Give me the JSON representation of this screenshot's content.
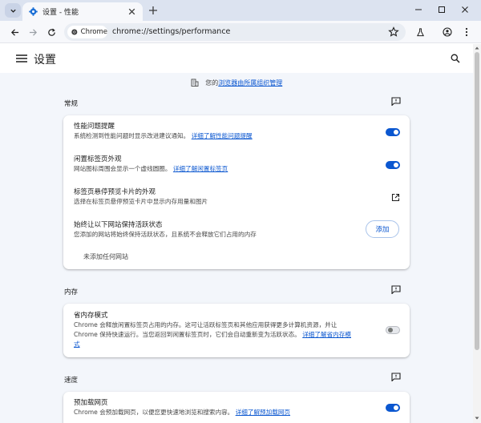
{
  "browser": {
    "tab_title": "设置 - 性能",
    "chip_label": "Chrome",
    "url_scheme": "chrome://",
    "url_rest": "settings/performance"
  },
  "settings": {
    "title": "设置",
    "managed_prefix": "您的",
    "managed_link": "浏览器由所属组织管理"
  },
  "sections": {
    "general": {
      "label": "常规",
      "rows": {
        "perf_alerts": {
          "title": "性能问题提醒",
          "desc": "系统检测到性能问题时显示改进建议通知。",
          "link": "详细了解性能问题提醒",
          "toggle": "on"
        },
        "inactive_tabs": {
          "title": "闲置标签页外观",
          "desc": "网站图标周围会显示一个虚线圆圈。",
          "link": "详细了解闲置标签页",
          "toggle": "on"
        },
        "hover_card": {
          "title": "标签页悬停预览卡片的外观",
          "desc": "选择在标签页悬停预览卡片中显示内存用量和图片"
        },
        "keep_active": {
          "title": "始终让以下网站保持活跃状态",
          "desc": "您添加的网站将始终保持活跃状态，且系统不会释放它们占用的内存",
          "button": "添加",
          "empty": "未添加任何网站"
        }
      }
    },
    "memory": {
      "label": "内存",
      "rows": {
        "memory_saver": {
          "title": "省内存模式",
          "desc_line1": "Chrome 会释放闲置标签页占用的内存。这可让活跃标签页和其他应用获得更多计算机资源，并让",
          "desc_line2": "Chrome 保持快速运行。当您返回到闲置标签页时，它们会自动重新变为活跃状态。",
          "link_part1": "详细了解省内存模",
          "link_part2": "式",
          "toggle": "off"
        }
      }
    },
    "speed": {
      "label": "速度",
      "rows": {
        "preload": {
          "title": "预加载网页",
          "desc": "Chrome 会预加载网页，以便您更快速地浏览和搜索内容。",
          "link": "详细了解预加载网页",
          "toggle": "on"
        }
      }
    }
  },
  "colors": {
    "accent": "#0b57d0",
    "page_bg": "#f3f6fb",
    "tabstrip_bg": "#dce3f0"
  },
  "icons": {
    "tab_search": "chevron-down-icon",
    "favicon": "settings-gear-icon",
    "tab_close": "close-icon",
    "new_tab": "plus-icon",
    "back": "arrow-left-icon",
    "forward": "arrow-right-icon",
    "reload": "reload-icon",
    "chrome": "chrome-logo-icon",
    "bookmark": "star-icon",
    "labs": "flask-icon",
    "profile": "profile-icon",
    "menu": "kebab-menu-icon",
    "hamburger": "hamburger-icon",
    "search": "search-icon",
    "managed": "building-icon",
    "feedback": "feedback-icon",
    "external": "open-external-icon"
  }
}
